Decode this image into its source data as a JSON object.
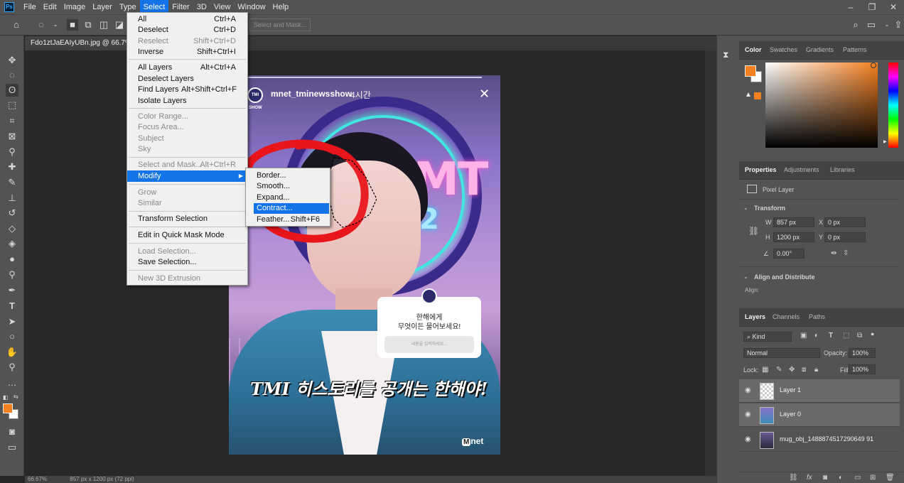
{
  "menubar": {
    "items": [
      "File",
      "Edit",
      "Image",
      "Layer",
      "Type",
      "Select",
      "Filter",
      "3D",
      "View",
      "Window",
      "Help"
    ],
    "active": "Select",
    "logo": "Ps"
  },
  "optionsbar": {
    "select_and_mask": "Select and Mask..."
  },
  "document": {
    "tab_title": "Fdo1ztJaEAIyUBn.jpg @ 66.7%",
    "zoom": "66.67%",
    "doc_size": "857 px x 1200 px (72 ppi)"
  },
  "image": {
    "username": "mnet_tminewsshow",
    "time_ago": "4시간",
    "avatar_text": "TMI SHOW",
    "question_line1": "한해에게",
    "question_line2": "무엇이든 물어보세요!",
    "question_placeholder": "내용을 입력하세요...",
    "caption": "TMI 히스토리를 공개는 한해야!",
    "logo": "net",
    "logo_m": "M",
    "sign1": "MT",
    "sign2": "2"
  },
  "select_menu": {
    "items": [
      {
        "label": "All",
        "shortcut": "Ctrl+A",
        "disabled": false
      },
      {
        "label": "Deselect",
        "shortcut": "Ctrl+D",
        "disabled": false
      },
      {
        "label": "Reselect",
        "shortcut": "Shift+Ctrl+D",
        "disabled": true
      },
      {
        "label": "Inverse",
        "shortcut": "Shift+Ctrl+I",
        "disabled": false
      },
      {
        "label": "All Layers",
        "shortcut": "Alt+Ctrl+A",
        "disabled": false
      },
      {
        "label": "Deselect Layers",
        "shortcut": "",
        "disabled": false
      },
      {
        "label": "Find Layers",
        "shortcut": "Alt+Shift+Ctrl+F",
        "disabled": false
      },
      {
        "label": "Isolate Layers",
        "shortcut": "",
        "disabled": false
      },
      {
        "label": "Color Range...",
        "shortcut": "",
        "disabled": true
      },
      {
        "label": "Focus Area...",
        "shortcut": "",
        "disabled": true
      },
      {
        "label": "Subject",
        "shortcut": "",
        "disabled": true
      },
      {
        "label": "Sky",
        "shortcut": "",
        "disabled": true
      },
      {
        "label": "Select and Mask...",
        "shortcut": "Alt+Ctrl+R",
        "disabled": true
      },
      {
        "label": "Modify",
        "shortcut": "",
        "disabled": false
      },
      {
        "label": "Grow",
        "shortcut": "",
        "disabled": true
      },
      {
        "label": "Similar",
        "shortcut": "",
        "disabled": true
      },
      {
        "label": "Transform Selection",
        "shortcut": "",
        "disabled": false
      },
      {
        "label": "Edit in Quick Mask Mode",
        "shortcut": "",
        "disabled": false
      },
      {
        "label": "Load Selection...",
        "shortcut": "",
        "disabled": true
      },
      {
        "label": "Save Selection...",
        "shortcut": "",
        "disabled": false
      },
      {
        "label": "New 3D Extrusion",
        "shortcut": "",
        "disabled": true
      }
    ],
    "highlighted": "Modify"
  },
  "modify_submenu": {
    "items": [
      {
        "label": "Border...",
        "shortcut": ""
      },
      {
        "label": "Smooth...",
        "shortcut": ""
      },
      {
        "label": "Expand...",
        "shortcut": ""
      },
      {
        "label": "Contract...",
        "shortcut": ""
      },
      {
        "label": "Feather...",
        "shortcut": "Shift+F6"
      }
    ],
    "highlighted": "Contract..."
  },
  "color_panel": {
    "tabs": [
      "Color",
      "Swatches",
      "Gradients",
      "Patterns"
    ],
    "active_tab": "Color",
    "foreground": "#f5801f",
    "background": "#ffffff"
  },
  "properties_panel": {
    "tabs": [
      "Properties",
      "Adjustments",
      "Libraries"
    ],
    "active_tab": "Properties",
    "layer_type": "Pixel Layer",
    "transform_label": "Transform",
    "w_label": "W",
    "w": "857 px",
    "h_label": "H",
    "h": "1200 px",
    "x_label": "X",
    "x": "0 px",
    "y_label": "Y",
    "y": "0 px",
    "angle": "0.00°",
    "align_label": "Align and Distribute",
    "align_sub": "Align:"
  },
  "layers_panel": {
    "tabs": [
      "Layers",
      "Channels",
      "Paths"
    ],
    "active_tab": "Layers",
    "filter": "Kind",
    "blend_mode": "Normal",
    "opacity_label": "Opacity:",
    "opacity": "100%",
    "lock_label": "Lock:",
    "fill_label": "Fill:",
    "fill": "100%",
    "layers": [
      {
        "name": "Layer 1",
        "selected": true,
        "thumb": "transparent"
      },
      {
        "name": "Layer 0",
        "selected": true,
        "thumb": "photo"
      },
      {
        "name": "mug_obj_1488874517290649 91",
        "selected": false,
        "thumb": "photo"
      }
    ]
  }
}
